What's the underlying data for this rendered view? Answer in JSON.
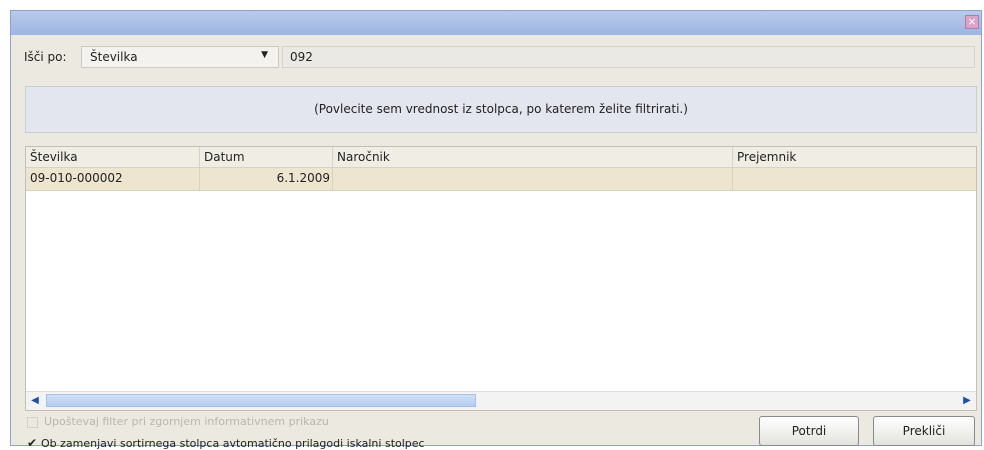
{
  "window": {
    "close_glyph": "×"
  },
  "search": {
    "label": "Išči po:",
    "field_selected": "Številka",
    "dropdown_arrow": "▼",
    "value": "092"
  },
  "hint": "(Povlecite sem vrednost iz stolpca, po katerem želite filtrirati.)",
  "table": {
    "columns": [
      "Številka",
      "Datum",
      "Naročnik",
      "Prejemnik"
    ],
    "rows": [
      [
        "09-010-000002",
        "6.1.2009",
        "",
        ""
      ]
    ]
  },
  "scrollbar": {
    "left_arrow": "◀",
    "right_arrow": "▶"
  },
  "options": {
    "respect_filter": {
      "label": "Upoštevaj filter pri zgornjem informativnem prikazu",
      "checked": false,
      "enabled": false
    },
    "auto_adjust": {
      "label": "Ob zamenjavi sortirnega stolpca avtomatično prilagodi iskalni stolpec",
      "checked": true,
      "check_glyph": "✔"
    }
  },
  "buttons": {
    "confirm": "Potrdi",
    "cancel": "Prekliči"
  }
}
